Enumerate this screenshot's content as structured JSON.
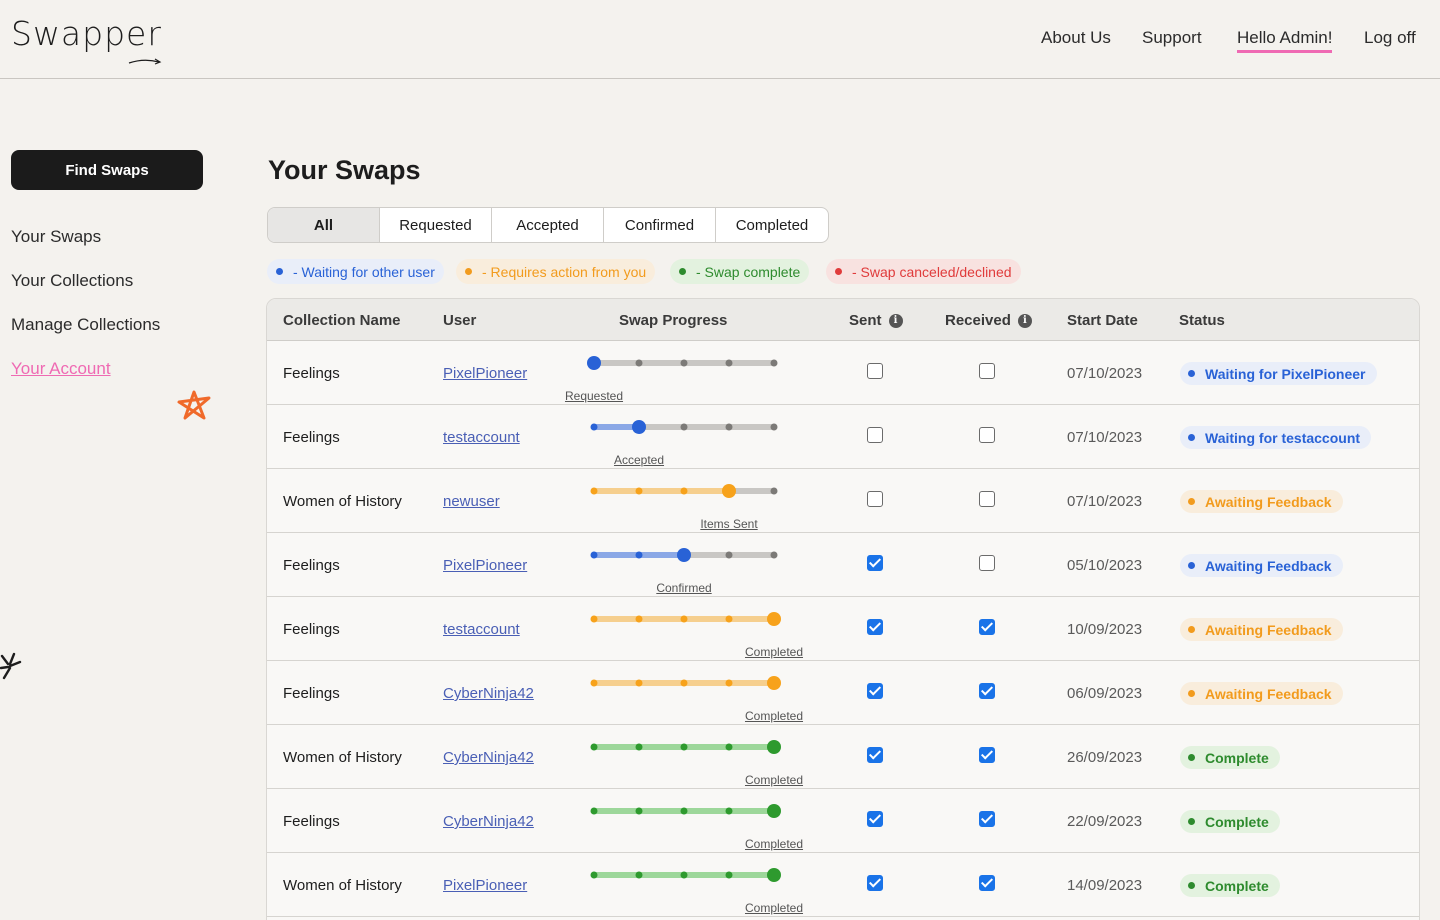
{
  "header": {
    "logo": "Swapper",
    "nav": [
      "About Us",
      "Support",
      "Hello Admin!",
      "Log off"
    ]
  },
  "sidebar": {
    "button": "Find Swaps",
    "links": [
      "Your Swaps",
      "Your Collections",
      "Manage Collections",
      "Your Account"
    ]
  },
  "main": {
    "title": "Your Swaps",
    "tabs": [
      "All",
      "Requested",
      "Accepted",
      "Confirmed",
      "Completed"
    ],
    "legend": [
      {
        "label": "- Waiting for other user",
        "color": "#2962d6",
        "bg": "#e9eef9"
      },
      {
        "label": "- Requires action from you",
        "color": "#f29b1d",
        "bg": "#f9eddc"
      },
      {
        "label": "- Swap complete",
        "color": "#2e8b2e",
        "bg": "#e3f2df"
      },
      {
        "label": "- Swap canceled/declined",
        "color": "#e03b3b",
        "bg": "#f8e2e0"
      }
    ],
    "columns": [
      "Collection Name",
      "User",
      "Swap Progress",
      "Sent",
      "Received",
      "Start Date",
      "Status"
    ],
    "rows": [
      {
        "collection": "Feelings",
        "user": "PixelPioneer",
        "step": 0,
        "color": "blue",
        "stage": "Requested",
        "sent": false,
        "received": false,
        "date": "07/10/2023",
        "status": "Waiting for PixelPioneer"
      },
      {
        "collection": "Feelings",
        "user": "testaccount",
        "step": 1,
        "color": "blue",
        "stage": "Accepted",
        "sent": false,
        "received": false,
        "date": "07/10/2023",
        "status": "Waiting for testaccount"
      },
      {
        "collection": "Women of History",
        "user": "newuser",
        "step": 3,
        "color": "orange",
        "stage": "Items Sent",
        "sent": false,
        "received": false,
        "date": "07/10/2023",
        "status": "Awaiting Feedback"
      },
      {
        "collection": "Feelings",
        "user": "PixelPioneer",
        "step": 2,
        "color": "blue",
        "stage": "Confirmed",
        "sent": true,
        "received": false,
        "date": "05/10/2023",
        "status": "Awaiting Feedback"
      },
      {
        "collection": "Feelings",
        "user": "testaccount",
        "step": 4,
        "color": "orange",
        "stage": "Completed",
        "sent": true,
        "received": true,
        "date": "10/09/2023",
        "status": "Awaiting Feedback"
      },
      {
        "collection": "Feelings",
        "user": "CyberNinja42",
        "step": 4,
        "color": "orange",
        "stage": "Completed",
        "sent": true,
        "received": true,
        "date": "06/09/2023",
        "status": "Awaiting Feedback"
      },
      {
        "collection": "Women of History",
        "user": "CyberNinja42",
        "step": 4,
        "color": "green",
        "stage": "Completed",
        "sent": true,
        "received": true,
        "date": "26/09/2023",
        "status": "Complete"
      },
      {
        "collection": "Feelings",
        "user": "CyberNinja42",
        "step": 4,
        "color": "green",
        "stage": "Completed",
        "sent": true,
        "received": true,
        "date": "22/09/2023",
        "status": "Complete"
      },
      {
        "collection": "Women of History",
        "user": "PixelPioneer",
        "step": 4,
        "color": "green",
        "stage": "Completed",
        "sent": true,
        "received": true,
        "date": "14/09/2023",
        "status": "Complete"
      }
    ]
  },
  "palette": {
    "blue": {
      "main": "#2962d6",
      "light": "#8ba8e6",
      "badge_text": "#2962d6",
      "badge_bg": "#e9eef9"
    },
    "orange": {
      "main": "#f7a21b",
      "light": "#f6cf8e",
      "badge_text": "#f29b1d",
      "badge_bg": "#f9eddc"
    },
    "green": {
      "main": "#2e9a2e",
      "light": "#9dd79a",
      "badge_text": "#2e8b2e",
      "badge_bg": "#e3f2df"
    },
    "track": "#c9c7c4",
    "track_dot": "#7c7a77"
  }
}
